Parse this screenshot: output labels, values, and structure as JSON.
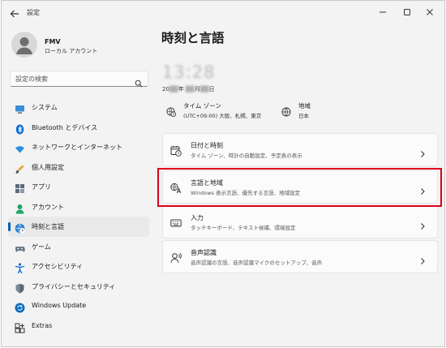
{
  "window": {
    "title": "設定"
  },
  "profile": {
    "name": "FMV",
    "account_type": "ローカル アカウント"
  },
  "search": {
    "placeholder": "設定の検索"
  },
  "sidebar": {
    "items": [
      {
        "label": "システム",
        "icon": "monitor-icon"
      },
      {
        "label": "Bluetooth とデバイス",
        "icon": "bluetooth-icon"
      },
      {
        "label": "ネットワークとインターネット",
        "icon": "wifi-icon"
      },
      {
        "label": "個人用設定",
        "icon": "brush-icon"
      },
      {
        "label": "アプリ",
        "icon": "apps-icon"
      },
      {
        "label": "アカウント",
        "icon": "person-icon"
      },
      {
        "label": "時刻と言語",
        "icon": "globe-clock-icon",
        "active": true
      },
      {
        "label": "ゲーム",
        "icon": "gamepad-icon"
      },
      {
        "label": "アクセシビリティ",
        "icon": "accessibility-icon"
      },
      {
        "label": "プライバシーとセキュリティ",
        "icon": "shield-icon"
      },
      {
        "label": "Windows Update",
        "icon": "update-icon"
      },
      {
        "label": "Extras",
        "icon": "extras-icon"
      }
    ]
  },
  "main": {
    "title": "時刻と言語",
    "clock": "13:28",
    "date": {
      "prefix": "20",
      "year_suffix": "年",
      "month_suffix": "月",
      "day_suffix": "日"
    },
    "timezone": {
      "title": "タイム ゾーン",
      "value": "(UTC+09:00) 大阪、札幌、東京"
    },
    "region": {
      "title": "地域",
      "value": "日本"
    },
    "cards": [
      {
        "title": "日付と時刻",
        "subtitle": "タイム ゾーン、時計の自動設定、予定表の表示",
        "icon": "calendar-clock-icon"
      },
      {
        "title": "言語と地域",
        "subtitle": "Windows 表示言語、優先する言語、地域設定",
        "icon": "language-icon"
      },
      {
        "title": "入力",
        "subtitle": "タッチキーボード、テキスト候補、環境設定",
        "icon": "keyboard-icon"
      },
      {
        "title": "音声認識",
        "subtitle": "音声認識の言語、音声認識マイクのセットアップ、音声",
        "icon": "speech-icon"
      }
    ]
  },
  "colors": {
    "accent": "#005fb8",
    "highlight": "#e0001b",
    "background": "#f3f3f3"
  }
}
